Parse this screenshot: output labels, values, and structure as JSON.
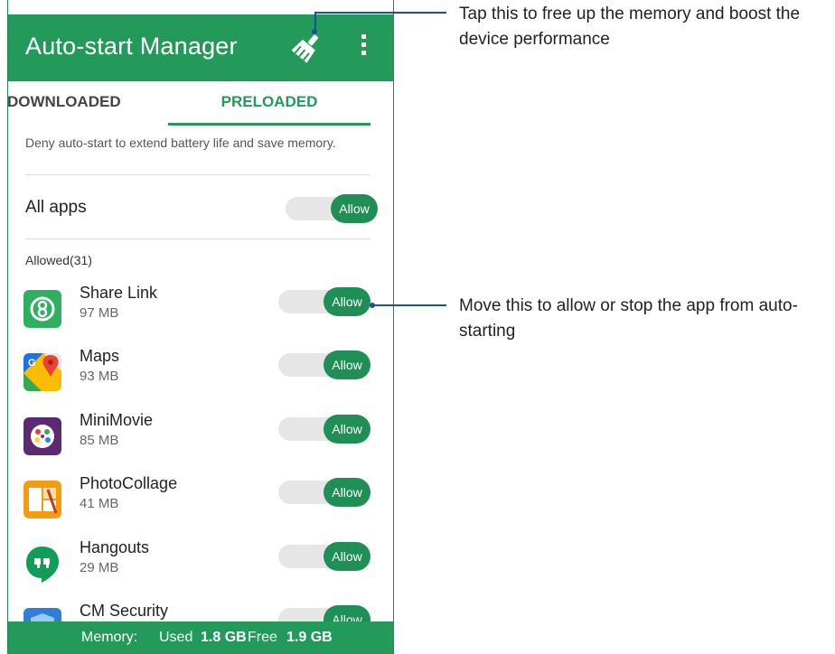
{
  "app_bar": {
    "title": "Auto-start Manager"
  },
  "tabs": [
    {
      "label": "DOWNLOADED",
      "active": false
    },
    {
      "label": "PRELOADED",
      "active": true
    }
  ],
  "description": "Deny auto-start to extend battery life and save memory.",
  "all_apps": {
    "label": "All apps",
    "toggle": "Allow"
  },
  "section_header": "Allowed(31)",
  "apps": [
    {
      "name": "Share Link",
      "size": "97 MB",
      "toggle": "Allow",
      "icon": "share-link-icon"
    },
    {
      "name": "Maps",
      "size": "93 MB",
      "toggle": "Allow",
      "icon": "maps-icon"
    },
    {
      "name": "MiniMovie",
      "size": "85 MB",
      "toggle": "Allow",
      "icon": "minimovie-icon"
    },
    {
      "name": "PhotoCollage",
      "size": "41 MB",
      "toggle": "Allow",
      "icon": "photocollage-icon"
    },
    {
      "name": "Hangouts",
      "size": "29 MB",
      "toggle": "Allow",
      "icon": "hangouts-icon"
    },
    {
      "name": "CM Security",
      "size": "",
      "toggle": "Allow",
      "icon": "cm-security-icon"
    }
  ],
  "bottom_bar": {
    "memory_label": "Memory:",
    "used_label": "Used",
    "used_value": "1.8 GB",
    "free_label": "Free",
    "free_value": "1.9 GB"
  },
  "callouts": {
    "boost": "Tap this to free up the memory and boost the device performance",
    "toggle": "Move this to allow or stop the app from auto-starting"
  },
  "colors": {
    "accent": "#239a5a",
    "callout_line": "#1c4f9c"
  }
}
